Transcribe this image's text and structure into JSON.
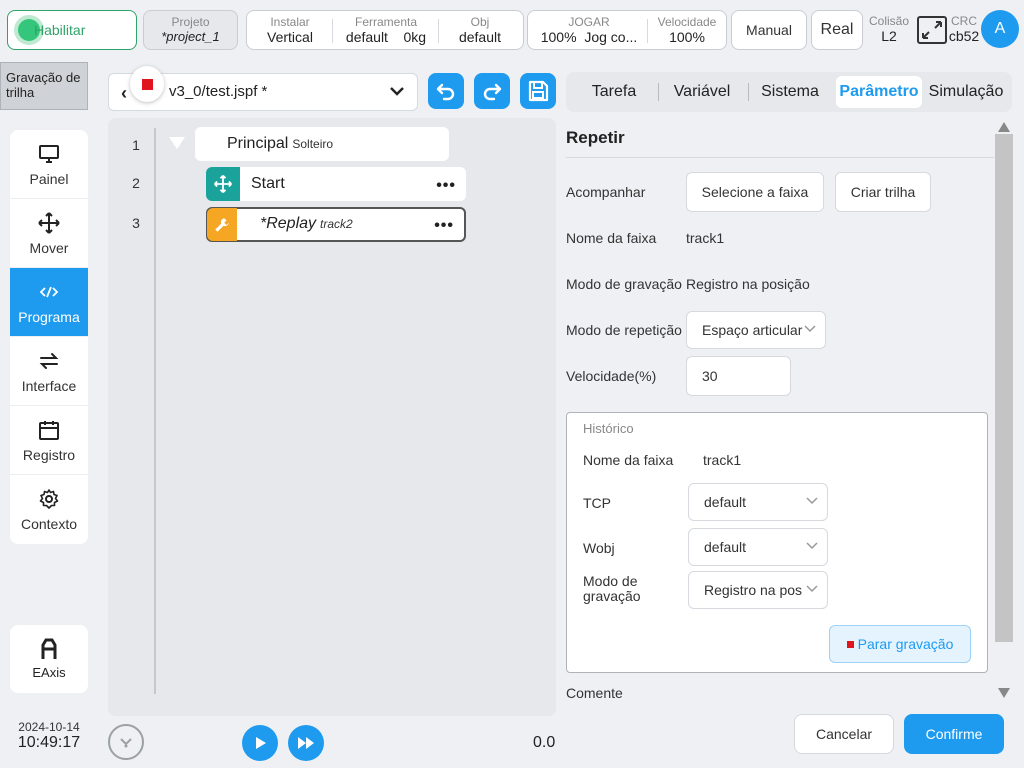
{
  "topbar": {
    "enable_label": "Habilitar",
    "project": {
      "label": "Projeto",
      "value": "*project_1"
    },
    "install": {
      "label": "Instalar",
      "value": "Vertical"
    },
    "tool": {
      "label": "Ferramenta",
      "value": "default",
      "weight": "0kg"
    },
    "obj": {
      "label": "Obj",
      "value": "default"
    },
    "play": {
      "label": "JOGAR",
      "percent": "100%",
      "mode": "Jog co..."
    },
    "speed": {
      "label": "Velocidade",
      "value": "100%"
    },
    "manual_label": "Manual",
    "real_label": "Real",
    "collision": {
      "label": "Colisão",
      "value": "L2"
    },
    "crc": {
      "label": "CRC",
      "value": "cb52"
    },
    "avatar_letter": "A"
  },
  "recording_tag": "Gravação de trilha",
  "file": {
    "name": "v3_0/test.jspf *"
  },
  "tabs": [
    "Tarefa",
    "Variável",
    "Sistema",
    "Parâmetro",
    "Simulação"
  ],
  "active_tab": "Parâmetro",
  "sidebar": {
    "items": [
      {
        "label": "Painel",
        "icon": "monitor-icon"
      },
      {
        "label": "Mover",
        "icon": "move-icon"
      },
      {
        "label": "Programa",
        "icon": "code-icon"
      },
      {
        "label": "Interface",
        "icon": "swap-icon"
      },
      {
        "label": "Registro",
        "icon": "calendar-icon"
      },
      {
        "label": "Contexto",
        "icon": "gear-icon"
      }
    ],
    "active": "Programa",
    "eaxis_label": "EAxis",
    "date": "2024-10-14",
    "time": "10:49:17"
  },
  "program": {
    "lines": [
      "1",
      "2",
      "3"
    ],
    "nodes": [
      {
        "title": "Principal",
        "sub": "Solteiro"
      },
      {
        "title": "Start",
        "sub": ""
      },
      {
        "title": "*Replay",
        "sub": "track2"
      }
    ],
    "more_glyph": "•••",
    "speed_readout": "0.0"
  },
  "param": {
    "title": "Repetir",
    "accompany_label": "Acompanhar",
    "select_track_label": "Selecione a faixa",
    "create_track_label": "Criar trilha",
    "track_name_label": "Nome da faixa",
    "track_name_value": "track1",
    "record_mode_label": "Modo de gravação",
    "record_mode_value": "Registro na posição",
    "repeat_mode_label": "Modo de repetição",
    "repeat_mode_value": "Espaço articular",
    "speed_label": "Velocidade(%)",
    "speed_value": "30",
    "history": {
      "legend": "Histórico",
      "track_name_label": "Nome da faixa",
      "track_name_value": "track1",
      "tcp_label": "TCP",
      "tcp_value": "default",
      "wobj_label": "Wobj",
      "wobj_value": "default",
      "mode_label_1": "Modo de",
      "mode_label_2": "gravação",
      "mode_value": "Registro na posição",
      "stop_label": "Parar gravação"
    },
    "comment_label": "Comente"
  },
  "footer": {
    "cancel_label": "Cancelar",
    "confirm_label": "Confirme"
  },
  "colors": {
    "accent": "#1e9bef",
    "enable": "#2ea36a",
    "move_node": "#1aa39a",
    "replay_node": "#f5a623",
    "record": "#e0161e"
  }
}
